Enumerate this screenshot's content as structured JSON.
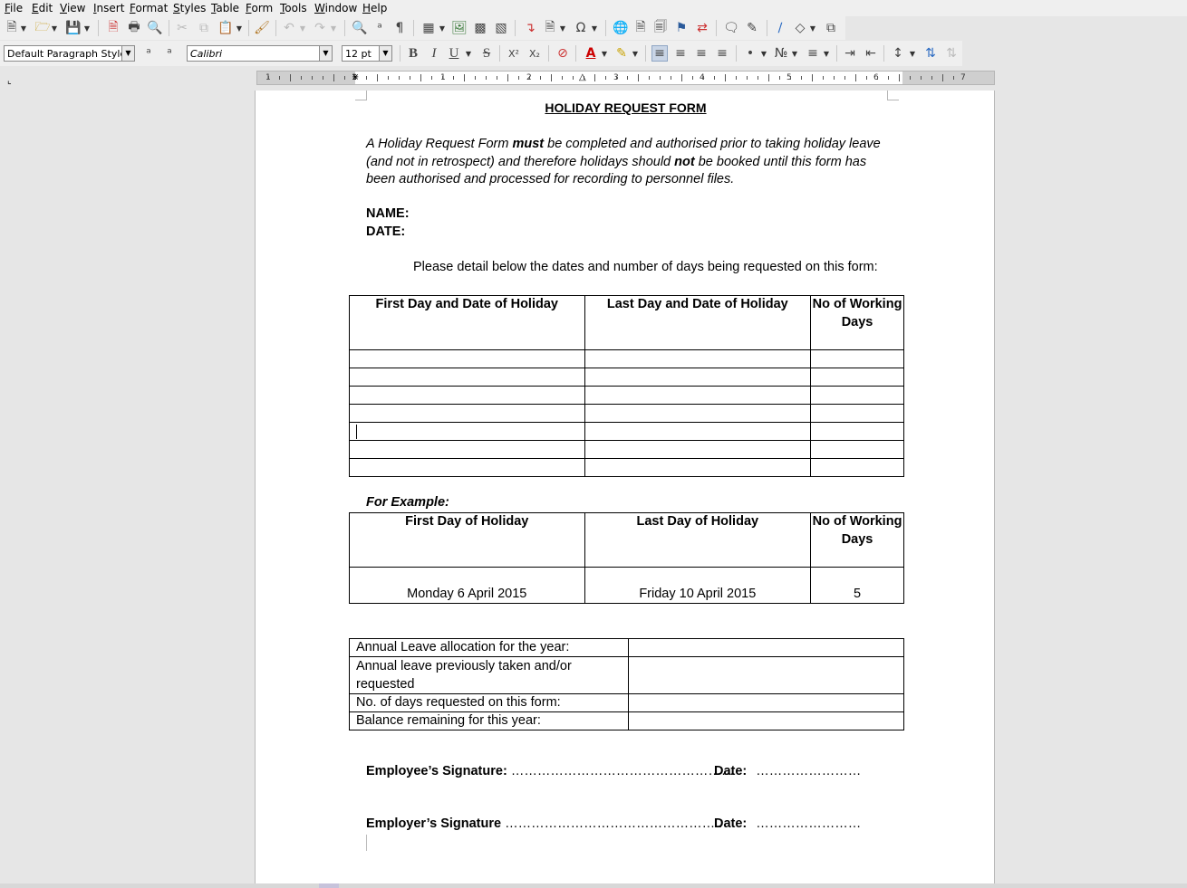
{
  "menu": [
    "File",
    "Edit",
    "View",
    "Insert",
    "Format",
    "Styles",
    "Table",
    "Form",
    "Tools",
    "Window",
    "Help"
  ],
  "toolbar2": {
    "paragraph_style": "Default Paragraph Style",
    "font_name": "Calibri",
    "font_size": "12 pt",
    "bold": "B",
    "italic": "I",
    "underline": "U",
    "strike": "S",
    "superscript": "X²",
    "subscript": "X₂"
  },
  "ruler": {
    "numbers": [
      "1",
      "1",
      "1",
      "2",
      "3",
      "4",
      "5",
      "6",
      "7"
    ]
  },
  "document": {
    "title": "HOLIDAY REQUEST FORM",
    "intro_part1": "A Holiday Request Form ",
    "intro_must": "must",
    "intro_part2": " be completed and authorised prior to taking holiday leave (and not in retrospect) and therefore holidays should ",
    "intro_not": "not",
    "intro_part3": " be booked until this form has been authorised and processed for recording to personnel files.",
    "name_label": "NAME:",
    "date_label": "DATE:",
    "detail_text": "Please detail below the dates and number of days being requested on this form:",
    "table1": {
      "headers": [
        "First Day and Date of Holiday",
        "Last Day and Date of Holiday",
        "No of Working Days"
      ]
    },
    "for_example": "For Example:",
    "table2": {
      "headers": [
        "First Day of Holiday",
        "Last Day of Holiday",
        "No of Working Days"
      ],
      "row": [
        "Monday 6 April 2015",
        "Friday 10 April 2015",
        "5"
      ]
    },
    "table3": {
      "rows": [
        "Annual Leave allocation for the year:",
        "Annual leave previously taken and/or requested",
        "No. of days requested on this form:",
        "Balance remaining for this year:"
      ]
    },
    "employee_sig_label": "Employee’s Signature:",
    "employee_sig_dots": "……………………………………………",
    "employee_date_label": "Date:",
    "employee_date_dots": "……………………",
    "employer_sig_label": "Employer’s Signature",
    "employer_sig_dots": "…………………………………………..",
    "employer_date_label": "Date:",
    "employer_date_dots": "……………………"
  }
}
